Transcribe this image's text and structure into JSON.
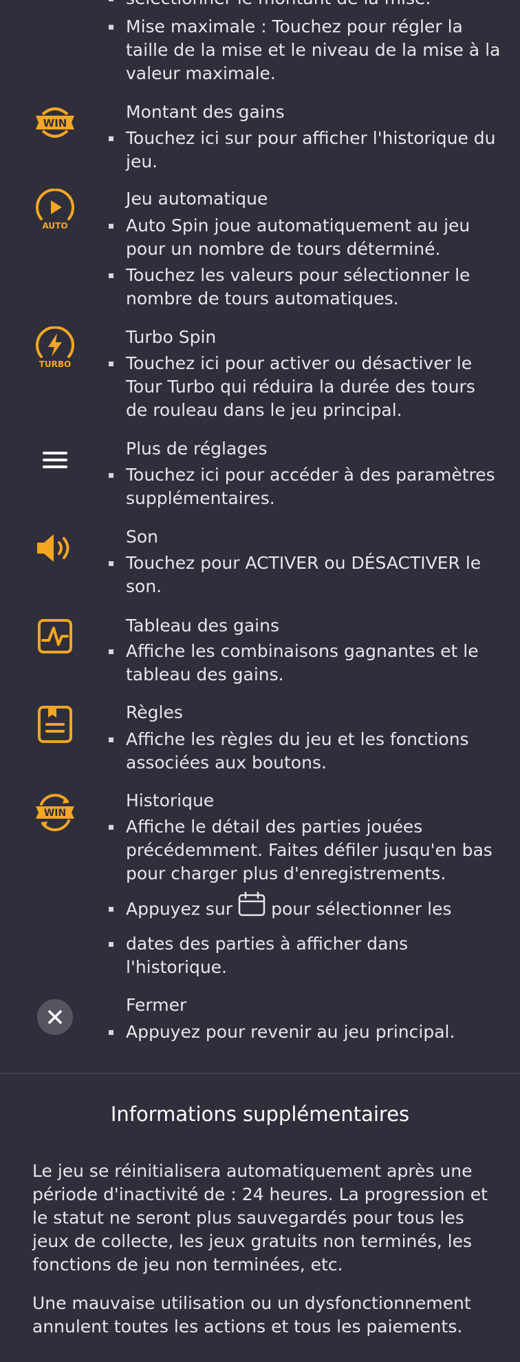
{
  "colors": {
    "background": "#2f2f3b",
    "accent": "#f5a623",
    "text": "#e6e6ea",
    "divider": "#3e3e4b"
  },
  "items": [
    {
      "icon": "",
      "title": "",
      "bullets": [
        "sélectionner le montant de la mise.",
        "Mise maximale : Touchez pour régler la taille de la mise et le niveau de la mise à la valeur maximale."
      ]
    },
    {
      "icon": "win-badge-icon",
      "icon_text": "WIN",
      "title": "Montant des gains",
      "bullets": [
        "Touchez ici sur pour afficher l'historique du jeu."
      ]
    },
    {
      "icon": "auto-play-icon",
      "icon_text": "AUTO",
      "title": "Jeu automatique",
      "bullets": [
        "Auto Spin joue automatiquement au jeu pour un nombre de tours déterminé.",
        "Touchez les valeurs pour sélectionner le nombre de tours automatiques."
      ]
    },
    {
      "icon": "turbo-bolt-icon",
      "icon_text": "TURBO",
      "title": "Turbo Spin",
      "bullets": [
        "Touchez ici pour activer ou désactiver le Tour Turbo qui réduira la durée des tours de rouleau dans le jeu principal."
      ]
    },
    {
      "icon": "menu-hamburger-icon",
      "title": "Plus de réglages",
      "bullets": [
        "Touchez ici pour accéder à des paramètres supplémentaires."
      ]
    },
    {
      "icon": "speaker-icon",
      "title": "Son",
      "bullets": [
        "Touchez pour ACTIVER ou DÉSACTIVER le son."
      ]
    },
    {
      "icon": "paytable-chart-icon",
      "title": "Tableau des gains",
      "bullets": [
        "Affiche les combinaisons gagnantes et le tableau des gains."
      ]
    },
    {
      "icon": "rules-document-icon",
      "title": "Règles",
      "bullets": [
        "Affiche les règles du jeu et les fonctions associées aux boutons."
      ]
    },
    {
      "icon": "history-win-icon",
      "icon_text": "WIN",
      "title": "Historique",
      "bullets": [
        "Affiche le détail des parties jouées précédemment. Faites défiler jusqu'en bas pour charger plus d'enregistrements."
      ],
      "calendar_bullet": {
        "before": "Appuyez sur",
        "after": "pour sélectionner les",
        "continuation": "dates des parties à afficher dans l'historique.",
        "icon": "calendar-icon"
      }
    },
    {
      "icon": "close-icon",
      "title": "Fermer",
      "bullets": [
        "Appuyez pour revenir au jeu principal."
      ]
    }
  ],
  "info": {
    "title": "Informations supplémentaires",
    "paragraphs": [
      "Le jeu se réinitialisera automatiquement après une période d'inactivité de : 24 heures. La progression et le statut ne seront plus sauvegardés pour tous les jeux de collecte, les jeux gratuits non terminés, les fonctions de jeu non terminées, etc.",
      "Une mauvaise utilisation ou un dysfonctionnement annulent toutes les actions et tous les paiements."
    ]
  }
}
